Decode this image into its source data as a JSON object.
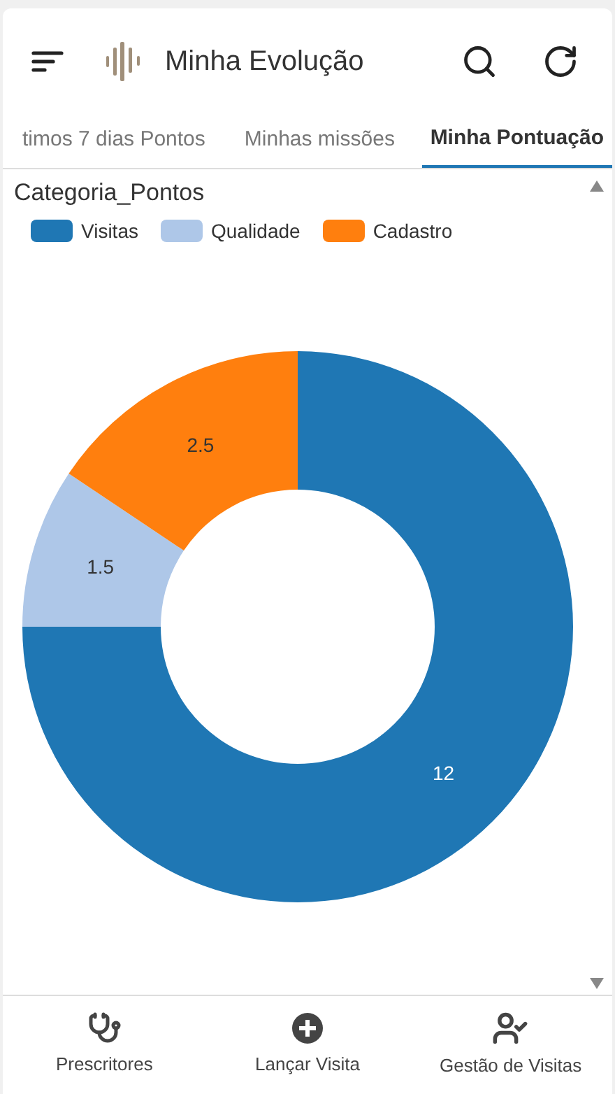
{
  "header": {
    "title": "Minha Evolução"
  },
  "tabs": [
    {
      "label": "timos 7 dias Pontos",
      "selected": false
    },
    {
      "label": "Minhas missões",
      "selected": false
    },
    {
      "label": "Minha Pontuação",
      "selected": true
    }
  ],
  "chart": {
    "chart_data": {
      "type": "donut",
      "title": "Categoria_Pontos",
      "categories": [
        "Visitas",
        "Qualidade",
        "Cadastro"
      ],
      "values": [
        12,
        1.5,
        2.5
      ],
      "colors": [
        "#1f77b4",
        "#aec7e8",
        "#ff7f0e"
      ],
      "data_labels": true
    }
  },
  "bottom_nav": [
    {
      "kind": "stethoscope",
      "label": "Prescritores"
    },
    {
      "kind": "add",
      "label": "Lançar Visita"
    },
    {
      "kind": "user-check",
      "label": "Gestão de Visitas"
    }
  ]
}
